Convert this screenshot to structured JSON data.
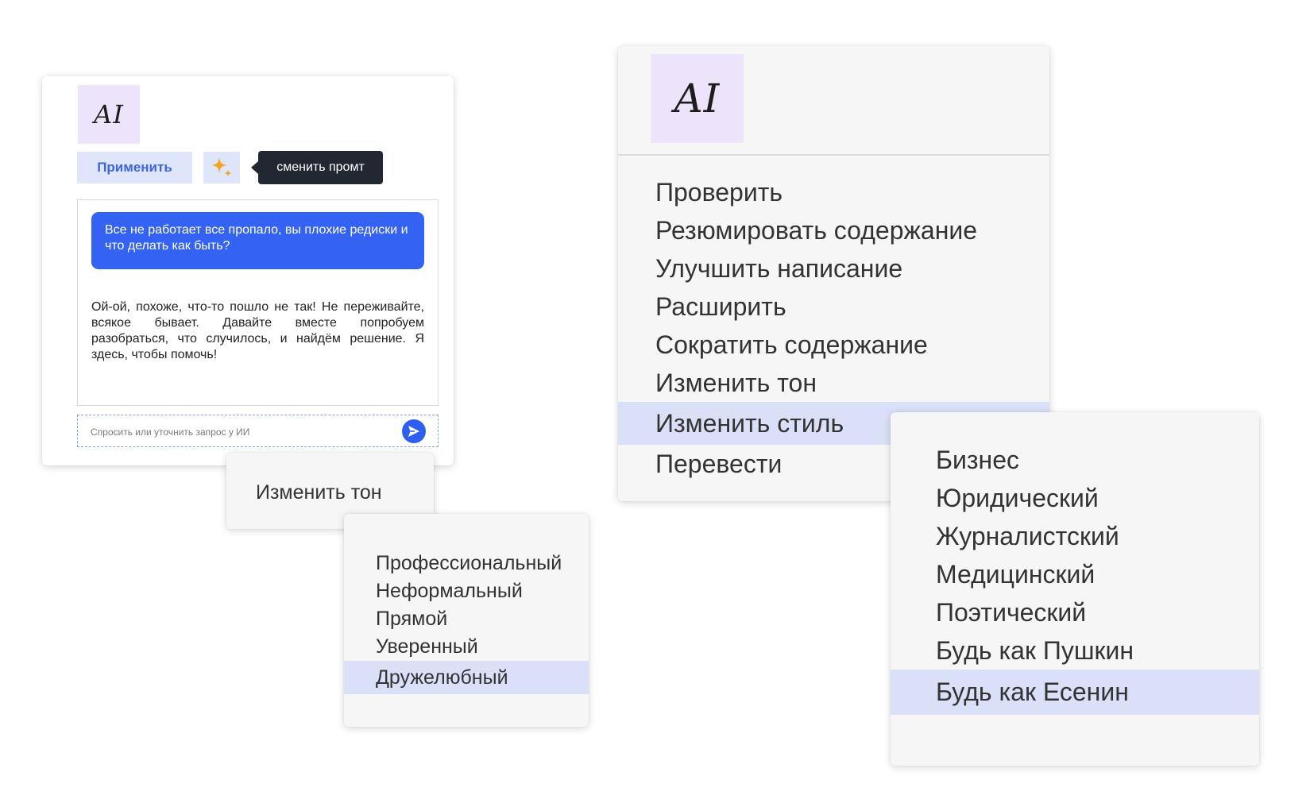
{
  "chat_panel": {
    "badge": "AI",
    "apply_label": "Применить",
    "tooltip": "сменить промт",
    "user_message": "Все не работает все пропало, вы плохие редиски и что делать как быть?",
    "ai_reply": "Ой-ой, похоже, что-то пошло не так! Не переживайте, всякое бывает. Давайте вместе попробуем разобраться, что случилось, и найдём решение. Я здесь, чтобы помочь!",
    "input_placeholder": "Спросить или уточнить запрос у ИИ"
  },
  "tone_parent_label": "Изменить тон",
  "tone_menu": {
    "items": [
      "Профессиональный",
      "Неформальный",
      "Прямой",
      "Уверенный",
      "Дружелюбный"
    ],
    "selected": "Дружелюбный"
  },
  "main_menu": {
    "badge": "AI",
    "items": [
      "Проверить",
      "Резюмировать содержание",
      "Улучшить написание",
      "Расширить",
      "Сократить содержание",
      "Изменить тон",
      "Изменить стиль",
      "Перевести"
    ],
    "selected": "Изменить стиль"
  },
  "style_menu": {
    "items": [
      "Бизнес",
      "Юридический",
      "Журналистский",
      "Медицинский",
      "Поэтический",
      "Будь как Пушкин",
      "Будь как Есенин"
    ],
    "selected": "Будь как Есенин"
  },
  "colors": {
    "accent_blue": "#3463f4",
    "selection_bg": "#d9e0f7",
    "badge_bg": "#ede3fb",
    "sparkle": "#f5a524"
  },
  "icons": {
    "sparkle": "sparkle-icon",
    "send": "send-arrow-icon"
  }
}
